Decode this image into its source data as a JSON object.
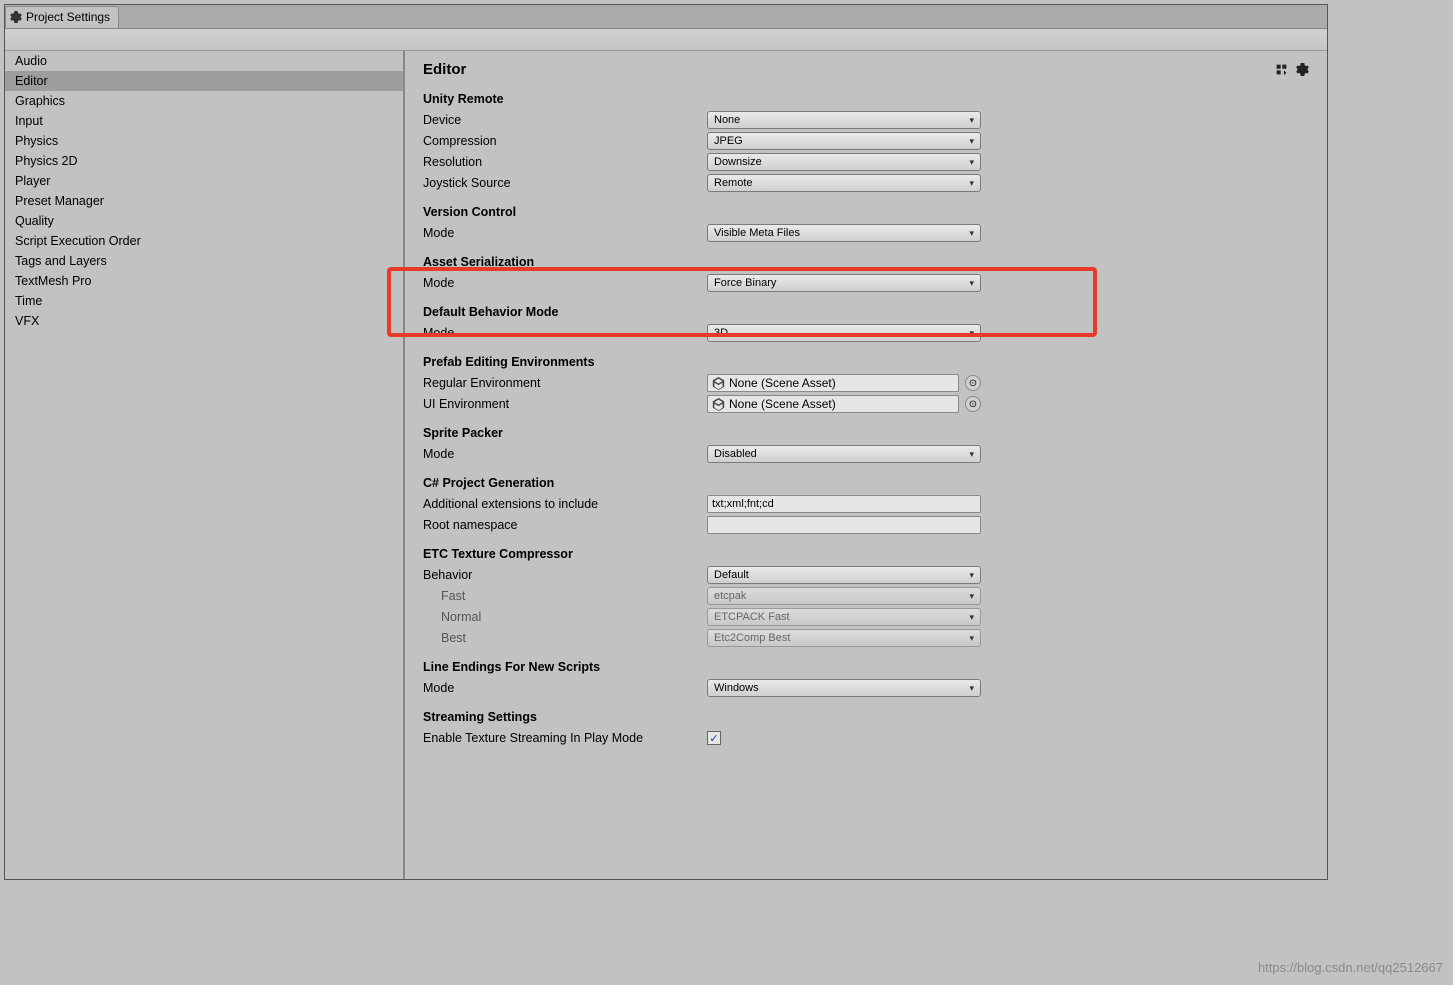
{
  "window": {
    "tab_title": "Project Settings"
  },
  "sidebar": {
    "items": [
      "Audio",
      "Editor",
      "Graphics",
      "Input",
      "Physics",
      "Physics 2D",
      "Player",
      "Preset Manager",
      "Quality",
      "Script Execution Order",
      "Tags and Layers",
      "TextMesh Pro",
      "Time",
      "VFX"
    ],
    "selected_index": 1
  },
  "main": {
    "title": "Editor",
    "sections": {
      "unity_remote": {
        "title": "Unity Remote",
        "device_label": "Device",
        "device_value": "None",
        "compression_label": "Compression",
        "compression_value": "JPEG",
        "resolution_label": "Resolution",
        "resolution_value": "Downsize",
        "joystick_label": "Joystick Source",
        "joystick_value": "Remote"
      },
      "version_control": {
        "title": "Version Control",
        "mode_label": "Mode",
        "mode_value": "Visible Meta Files"
      },
      "asset_serialization": {
        "title": "Asset Serialization",
        "mode_label": "Mode",
        "mode_value": "Force Binary"
      },
      "default_behavior": {
        "title": "Default Behavior Mode",
        "mode_label": "Mode",
        "mode_value": "3D"
      },
      "prefab_env": {
        "title": "Prefab Editing Environments",
        "regular_label": "Regular Environment",
        "regular_value": "None (Scene Asset)",
        "ui_label": "UI Environment",
        "ui_value": "None (Scene Asset)"
      },
      "sprite_packer": {
        "title": "Sprite Packer",
        "mode_label": "Mode",
        "mode_value": "Disabled"
      },
      "csharp_gen": {
        "title": "C# Project Generation",
        "ext_label": "Additional extensions to include",
        "ext_value": "txt;xml;fnt;cd",
        "ns_label": "Root namespace",
        "ns_value": ""
      },
      "etc_compressor": {
        "title": "ETC Texture Compressor",
        "behavior_label": "Behavior",
        "behavior_value": "Default",
        "fast_label": "Fast",
        "fast_value": "etcpak",
        "normal_label": "Normal",
        "normal_value": "ETCPACK Fast",
        "best_label": "Best",
        "best_value": "Etc2Comp Best"
      },
      "line_endings": {
        "title": "Line Endings For New Scripts",
        "mode_label": "Mode",
        "mode_value": "Windows"
      },
      "streaming": {
        "title": "Streaming Settings",
        "enable_label": "Enable Texture Streaming In Play Mode",
        "enable_value": true
      }
    }
  },
  "watermark": "https://blog.csdn.net/qq2512667"
}
